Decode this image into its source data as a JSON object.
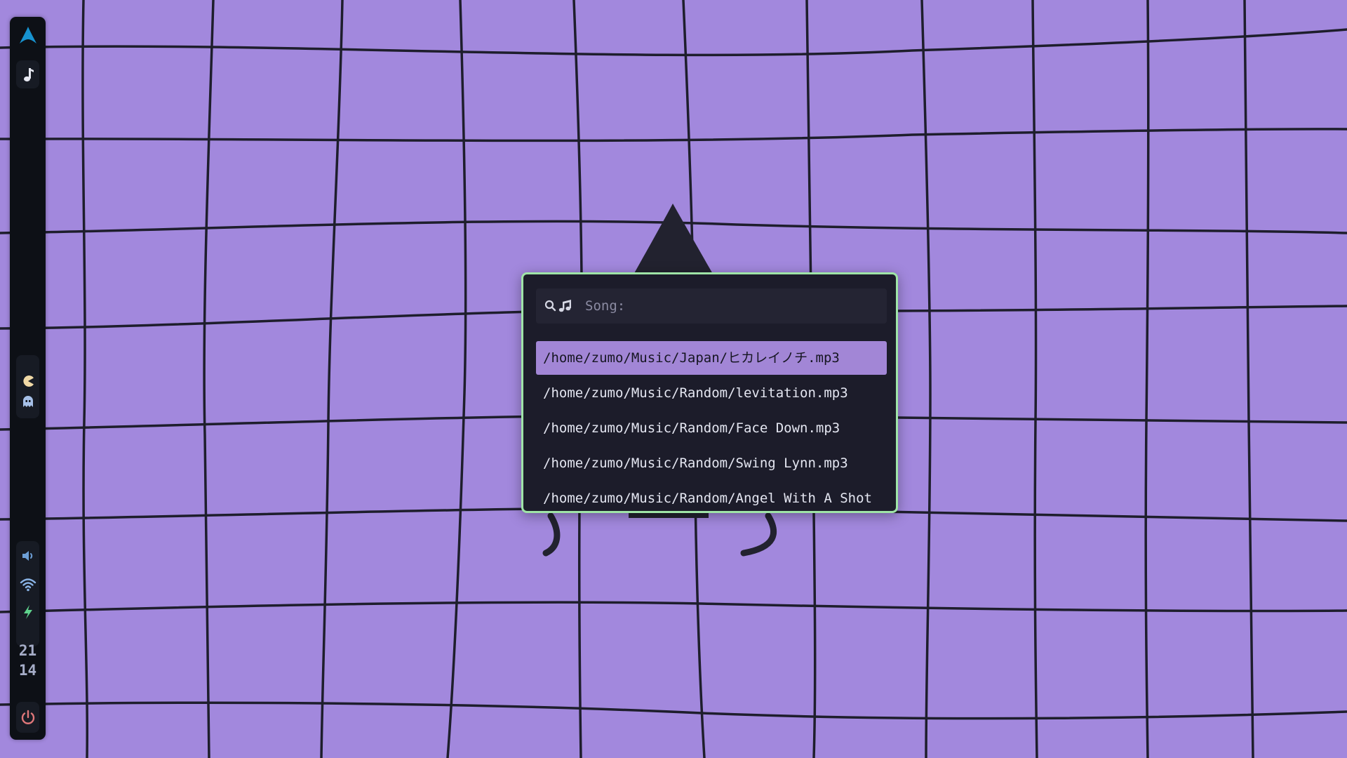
{
  "colors": {
    "wallpaper": "#a288dd",
    "grid_lines": "#1e1e2c",
    "bar_background": "#0d1016",
    "arch_logo": "#1793d1",
    "launcher_border": "#9fe4a7",
    "selected_row": "#a286d6",
    "volume": "#6d9fd6",
    "wifi": "#8ab4e6",
    "battery": "#5fd38d",
    "power": "#e0777a"
  },
  "bar": {
    "top_icons": [
      "arch-logo-icon",
      "music-note-icon"
    ],
    "workspace_icons": [
      "pacman-icon",
      "ghost-icon"
    ],
    "status_icons": [
      "volume-icon",
      "wifi-icon",
      "charging-bolt-icon"
    ],
    "clock": {
      "hour": "21",
      "minute": "14"
    },
    "bottom_icon": "power-icon"
  },
  "launcher": {
    "prompt": "Song:",
    "input_value": "",
    "icons": [
      "search-icon",
      "music-notes-icon"
    ],
    "selected_index": 0,
    "results": [
      "/home/zumo/Music/Japan/ヒカレイノチ.mp3",
      "/home/zumo/Music/Random/levitation.mp3",
      "/home/zumo/Music/Random/Face Down.mp3",
      "/home/zumo/Music/Random/Swing Lynn.mp3",
      "/home/zumo/Music/Random/Angel With A Shot"
    ]
  }
}
